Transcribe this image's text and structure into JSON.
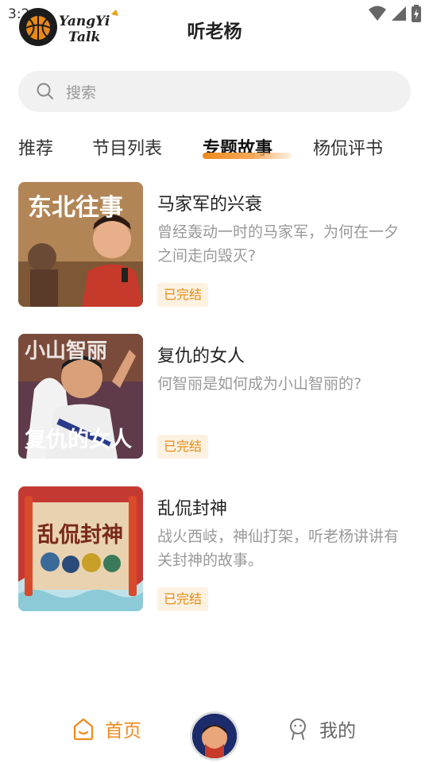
{
  "status": {
    "time": "3:2"
  },
  "header": {
    "logo_text_1": "YangYi",
    "logo_text_2": "Talk",
    "title": "听老杨"
  },
  "search": {
    "placeholder": "搜索"
  },
  "tabs": [
    {
      "label": "推荐",
      "active": false
    },
    {
      "label": "节目列表",
      "active": false
    },
    {
      "label": "专题故事",
      "active": true
    },
    {
      "label": "杨侃评书",
      "active": false
    }
  ],
  "stories": [
    {
      "title": "马家军的兴衰",
      "desc": "曾经轰动一时的马家军，为何在一夕之间走向毁灭?",
      "badge": "已完结",
      "cover_text": "东北往事"
    },
    {
      "title": "复仇的女人",
      "desc": "何智丽是如何成为小山智丽的?",
      "badge": "已完结",
      "cover_text_top": "小山智丽",
      "cover_text_bottom": "复仇的女人"
    },
    {
      "title": "乱侃封神",
      "desc": "战火西岐，神仙打架，听老杨讲讲有关封神的故事。",
      "badge": "已完结",
      "cover_text": "乱侃封神"
    }
  ],
  "nav": {
    "home": "首页",
    "mine": "我的"
  },
  "colors": {
    "accent": "#f08a1c",
    "badge_bg": "#fdf2e2",
    "search_bg": "#f1f1f1"
  }
}
